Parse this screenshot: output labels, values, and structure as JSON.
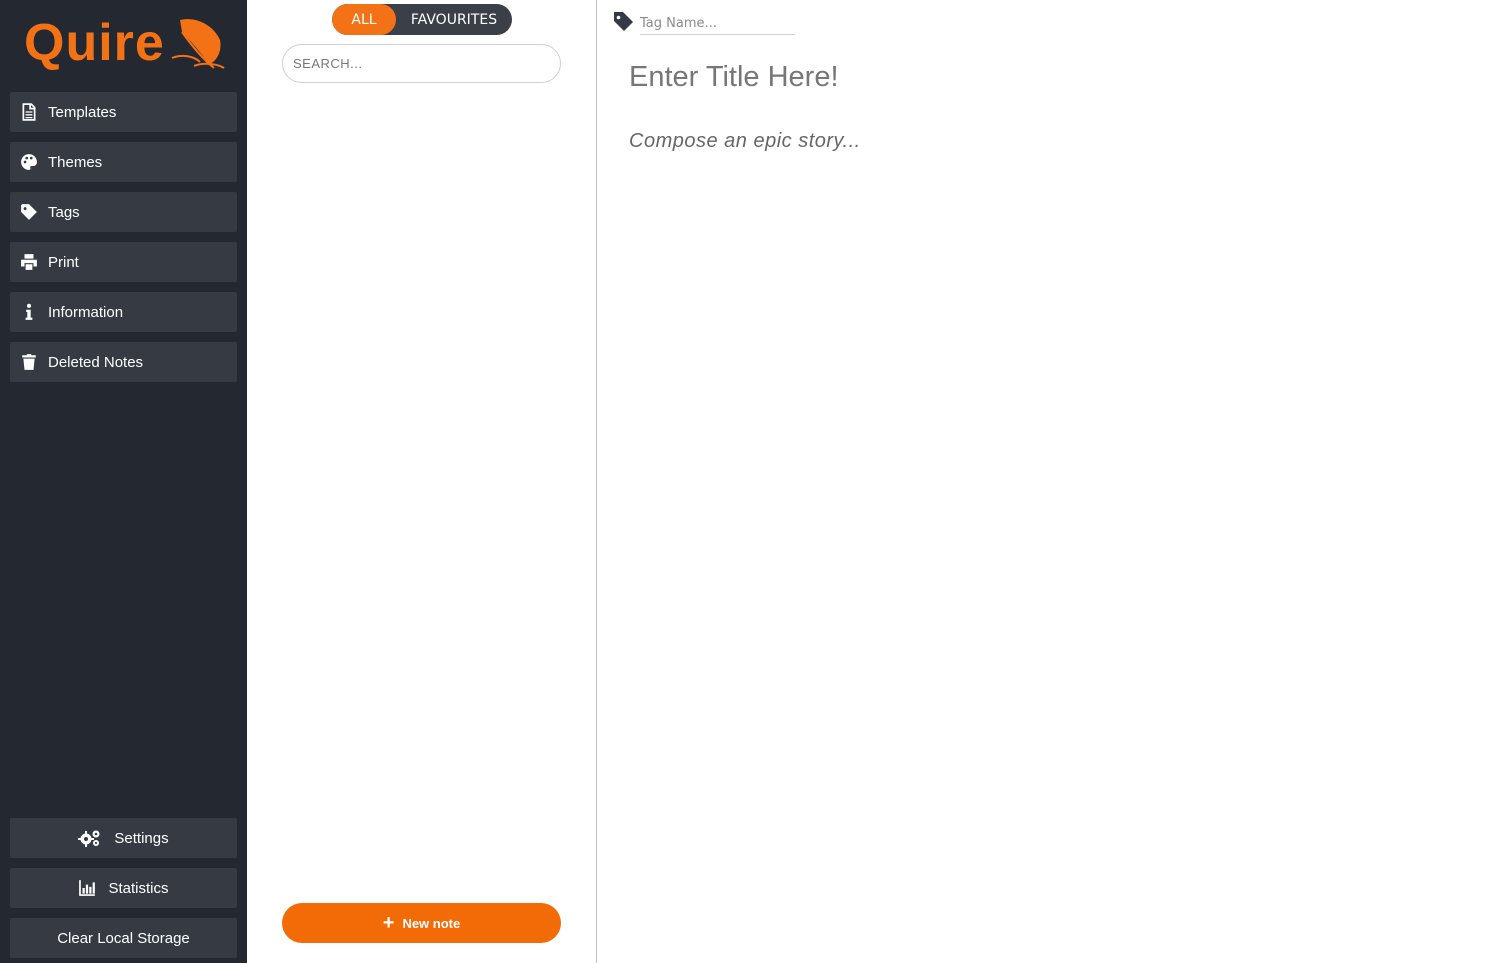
{
  "brand": {
    "name": "Quire",
    "color": "#f47216"
  },
  "sidebar": {
    "items": [
      {
        "label": "Templates",
        "icon": "file-icon"
      },
      {
        "label": "Themes",
        "icon": "palette-icon"
      },
      {
        "label": "Tags",
        "icon": "tag-icon"
      },
      {
        "label": "Print",
        "icon": "printer-icon"
      },
      {
        "label": "Information",
        "icon": "info-icon"
      },
      {
        "label": "Deleted Notes",
        "icon": "trash-icon"
      }
    ],
    "bottom": [
      {
        "label": "Settings",
        "icon": "gears-icon"
      },
      {
        "label": "Statistics",
        "icon": "bar-chart-icon"
      },
      {
        "label": "Clear Local Storage"
      }
    ]
  },
  "notes": {
    "toggle": {
      "all": "ALL",
      "favourites": "FAVOURITES",
      "selected": "ALL"
    },
    "search_placeholder": "SEARCH...",
    "new_note_label": "New note"
  },
  "editor": {
    "tag_placeholder": "Tag Name...",
    "title_placeholder": "Enter Title Here!",
    "body_placeholder": "Compose an epic story..."
  },
  "colors": {
    "sidebar_bg": "#232831",
    "button_bg": "#353a43",
    "accent": "#f47216"
  }
}
